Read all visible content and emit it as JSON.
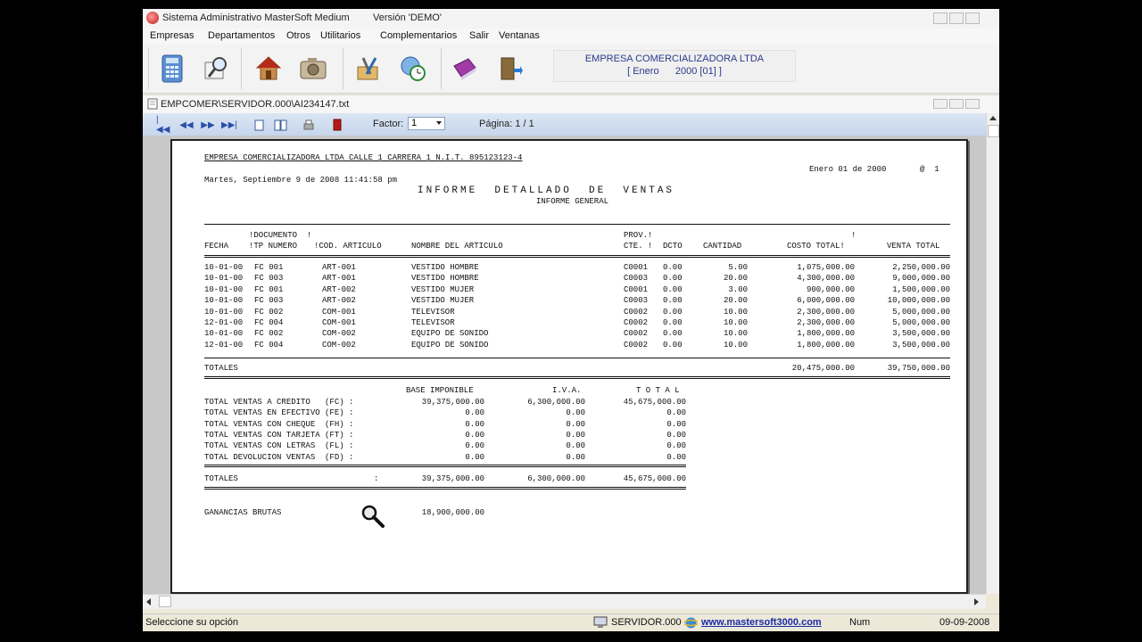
{
  "window": {
    "title": "Sistema Administrativo MasterSoft Medium",
    "version": "Versión 'DEMO'"
  },
  "menu": [
    "Empresas",
    "Departamentos",
    "Otros",
    "Utilitarios",
    "Complementarios",
    "Salir",
    "Ventanas"
  ],
  "toolbar_icons": [
    "calculator-icon",
    "search-document-icon",
    "home-icon",
    "camera-icon",
    "tools-icon",
    "globe-clock-icon",
    "book-icon",
    "exit-door-icon"
  ],
  "company": {
    "name": "EMPRESA COMERCIALIZADORA LTDA",
    "period": "[ Enero      2000 [01] ]"
  },
  "document_window": {
    "path": "EMPCOMER\\SERVIDOR.000\\AI234147.txt"
  },
  "viewer": {
    "factor_label": "Factor:",
    "factor_value": "1",
    "page_label": "Página: 1 / 1"
  },
  "report": {
    "header_line": "EMPRESA COMERCIALIZADORA LTDA CALLE 1 CARRERA 1 N.I.T. 895123123-4",
    "date_line": "Enero 01 de 2000",
    "page_mark": "@  1",
    "timestamp": "Martes, Septiembre 9 de 2008 11:41:58 pm",
    "title": "INFORME  DETALLADO  DE  VENTAS",
    "subtitle": "INFORME GENERAL",
    "columns": {
      "fecha": "FECHA",
      "doc_top": "!DOCUMENTO  !",
      "doc_bottom": "!TP NUMERO",
      "cod": "!COD. ARTICULO",
      "nombre": "NOMBRE DEL ARTICULO",
      "prov_top": "PROV.!",
      "prov_bottom": "CTE. !",
      "dcto": "DCTO",
      "cantidad": "CANTIDAD",
      "costo_top": "!",
      "costo": "COSTO TOTAL!",
      "venta": "VENTA TOTAL"
    },
    "rows": [
      {
        "fecha": "10-01-00",
        "doc": "FC 001",
        "cod": "ART-001",
        "nombre": "VESTIDO HOMBRE",
        "prov": "C0001",
        "dcto": "0.00",
        "cantidad": "5.00",
        "costo": "1,075,000.00",
        "venta": "2,250,000.00"
      },
      {
        "fecha": "10-01-00",
        "doc": "FC 003",
        "cod": "ART-001",
        "nombre": "VESTIDO HOMBRE",
        "prov": "C0003",
        "dcto": "0.00",
        "cantidad": "20.00",
        "costo": "4,300,000.00",
        "venta": "9,000,000.00"
      },
      {
        "fecha": "10-01-00",
        "doc": "FC 001",
        "cod": "ART-002",
        "nombre": "VESTIDO MUJER",
        "prov": "C0001",
        "dcto": "0.00",
        "cantidad": "3.00",
        "costo": "900,000.00",
        "venta": "1,500,000.00"
      },
      {
        "fecha": "10-01-00",
        "doc": "FC 003",
        "cod": "ART-002",
        "nombre": "VESTIDO MUJER",
        "prov": "C0003",
        "dcto": "0.00",
        "cantidad": "20.00",
        "costo": "6,000,000.00",
        "venta": "10,000,000.00"
      },
      {
        "fecha": "10-01-00",
        "doc": "FC 002",
        "cod": "COM-001",
        "nombre": "TELEVISOR",
        "prov": "C0002",
        "dcto": "0.00",
        "cantidad": "10.00",
        "costo": "2,300,000.00",
        "venta": "5,000,000.00"
      },
      {
        "fecha": "12-01-00",
        "doc": "FC 004",
        "cod": "COM-001",
        "nombre": "TELEVISOR",
        "prov": "C0002",
        "dcto": "0.00",
        "cantidad": "10.00",
        "costo": "2,300,000.00",
        "venta": "5,000,000.00"
      },
      {
        "fecha": "10-01-00",
        "doc": "FC 002",
        "cod": "COM-002",
        "nombre": "EQUIPO DE SONIDO",
        "prov": "C0002",
        "dcto": "0.00",
        "cantidad": "10.00",
        "costo": "1,800,000.00",
        "venta": "3,500,000.00"
      },
      {
        "fecha": "12-01-00",
        "doc": "FC 004",
        "cod": "COM-002",
        "nombre": "EQUIPO DE SONIDO",
        "prov": "C0002",
        "dcto": "0.00",
        "cantidad": "10.00",
        "costo": "1,800,000.00",
        "venta": "3,500,000.00"
      }
    ],
    "totales_label": "TOTALES",
    "totales_costo": "20,475,000.00",
    "totales_venta": "39,750,000.00",
    "summary_headers": {
      "base": "BASE IMPONIBLE",
      "iva": "I.V.A.",
      "total": "T O T A L"
    },
    "summary_rows": [
      {
        "label": "TOTAL VENTAS A CREDITO   (FC) :",
        "base": "39,375,000.00",
        "iva": "6,300,000.00",
        "total": "45,675,000.00"
      },
      {
        "label": "TOTAL VENTAS EN EFECTIVO (FE) :",
        "base": "0.00",
        "iva": "0.00",
        "total": "0.00"
      },
      {
        "label": "TOTAL VENTAS CON CHEQUE  (FH) :",
        "base": "0.00",
        "iva": "0.00",
        "total": "0.00"
      },
      {
        "label": "TOTAL VENTAS CON TARJETA (FT) :",
        "base": "0.00",
        "iva": "0.00",
        "total": "0.00"
      },
      {
        "label": "TOTAL VENTAS CON LETRAS  (FL) :",
        "base": "0.00",
        "iva": "0.00",
        "total": "0.00"
      },
      {
        "label": "TOTAL DEVOLUCION VENTAS  (FD) :",
        "base": "0.00",
        "iva": "0.00",
        "total": "0.00"
      }
    ],
    "summary_totals": {
      "label": "TOTALES",
      "colon": ":",
      "base": "39,375,000.00",
      "iva": "6,300,000.00",
      "total": "45,675,000.00"
    },
    "ganancias_label": "GANANCIAS BRUTAS",
    "ganancias_value": "18,900,000.00"
  },
  "statusbar": {
    "hint": "Seleccione su opción",
    "server": "SERVIDOR.000",
    "website": "www.mastersoft3000.com",
    "num": "Num",
    "date": "09-09-2008"
  }
}
